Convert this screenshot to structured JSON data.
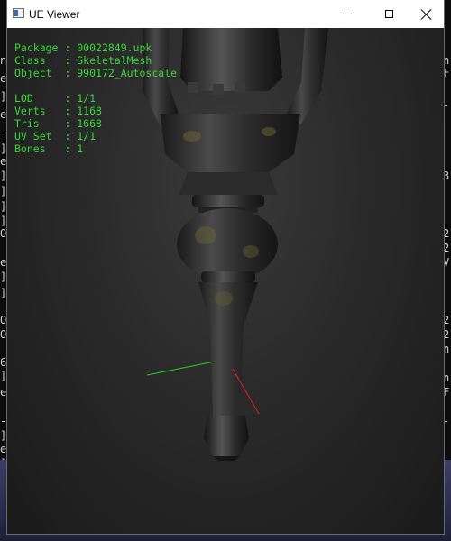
{
  "window": {
    "title": "UE Viewer"
  },
  "info": {
    "package": {
      "label": "Package",
      "value": "00022849.upk"
    },
    "class": {
      "label": "Class",
      "value": "SkeletalMesh"
    },
    "object": {
      "label": "Object",
      "value": "990172_Autoscale"
    },
    "lod": {
      "label": "LOD",
      "value": "1/1"
    },
    "verts": {
      "label": "Verts",
      "value": "1168"
    },
    "tris": {
      "label": "Tris",
      "value": "1668"
    },
    "uvset": {
      "label": "UV Set",
      "value": "1/1"
    },
    "bones": {
      "label": "Bones",
      "value": "1"
    }
  },
  "background_console": {
    "left_glyphs": [
      "n",
      "e",
      "]",
      "e",
      "-",
      "]",
      "e",
      "]",
      "]",
      "]",
      "]",
      "O",
      "e",
      "]",
      "]",
      "O",
      "O",
      "6",
      "]",
      "e",
      "-",
      "]",
      "e",
      "]"
    ],
    "right_glyphs": [
      "n",
      "F",
      "-",
      "3",
      "2",
      "2",
      "V",
      "2",
      "2",
      "n",
      "n",
      "F",
      "-"
    ]
  },
  "colors": {
    "info_text": "#38d838",
    "axis_x": "#e02020",
    "axis_y": "#20d020"
  }
}
